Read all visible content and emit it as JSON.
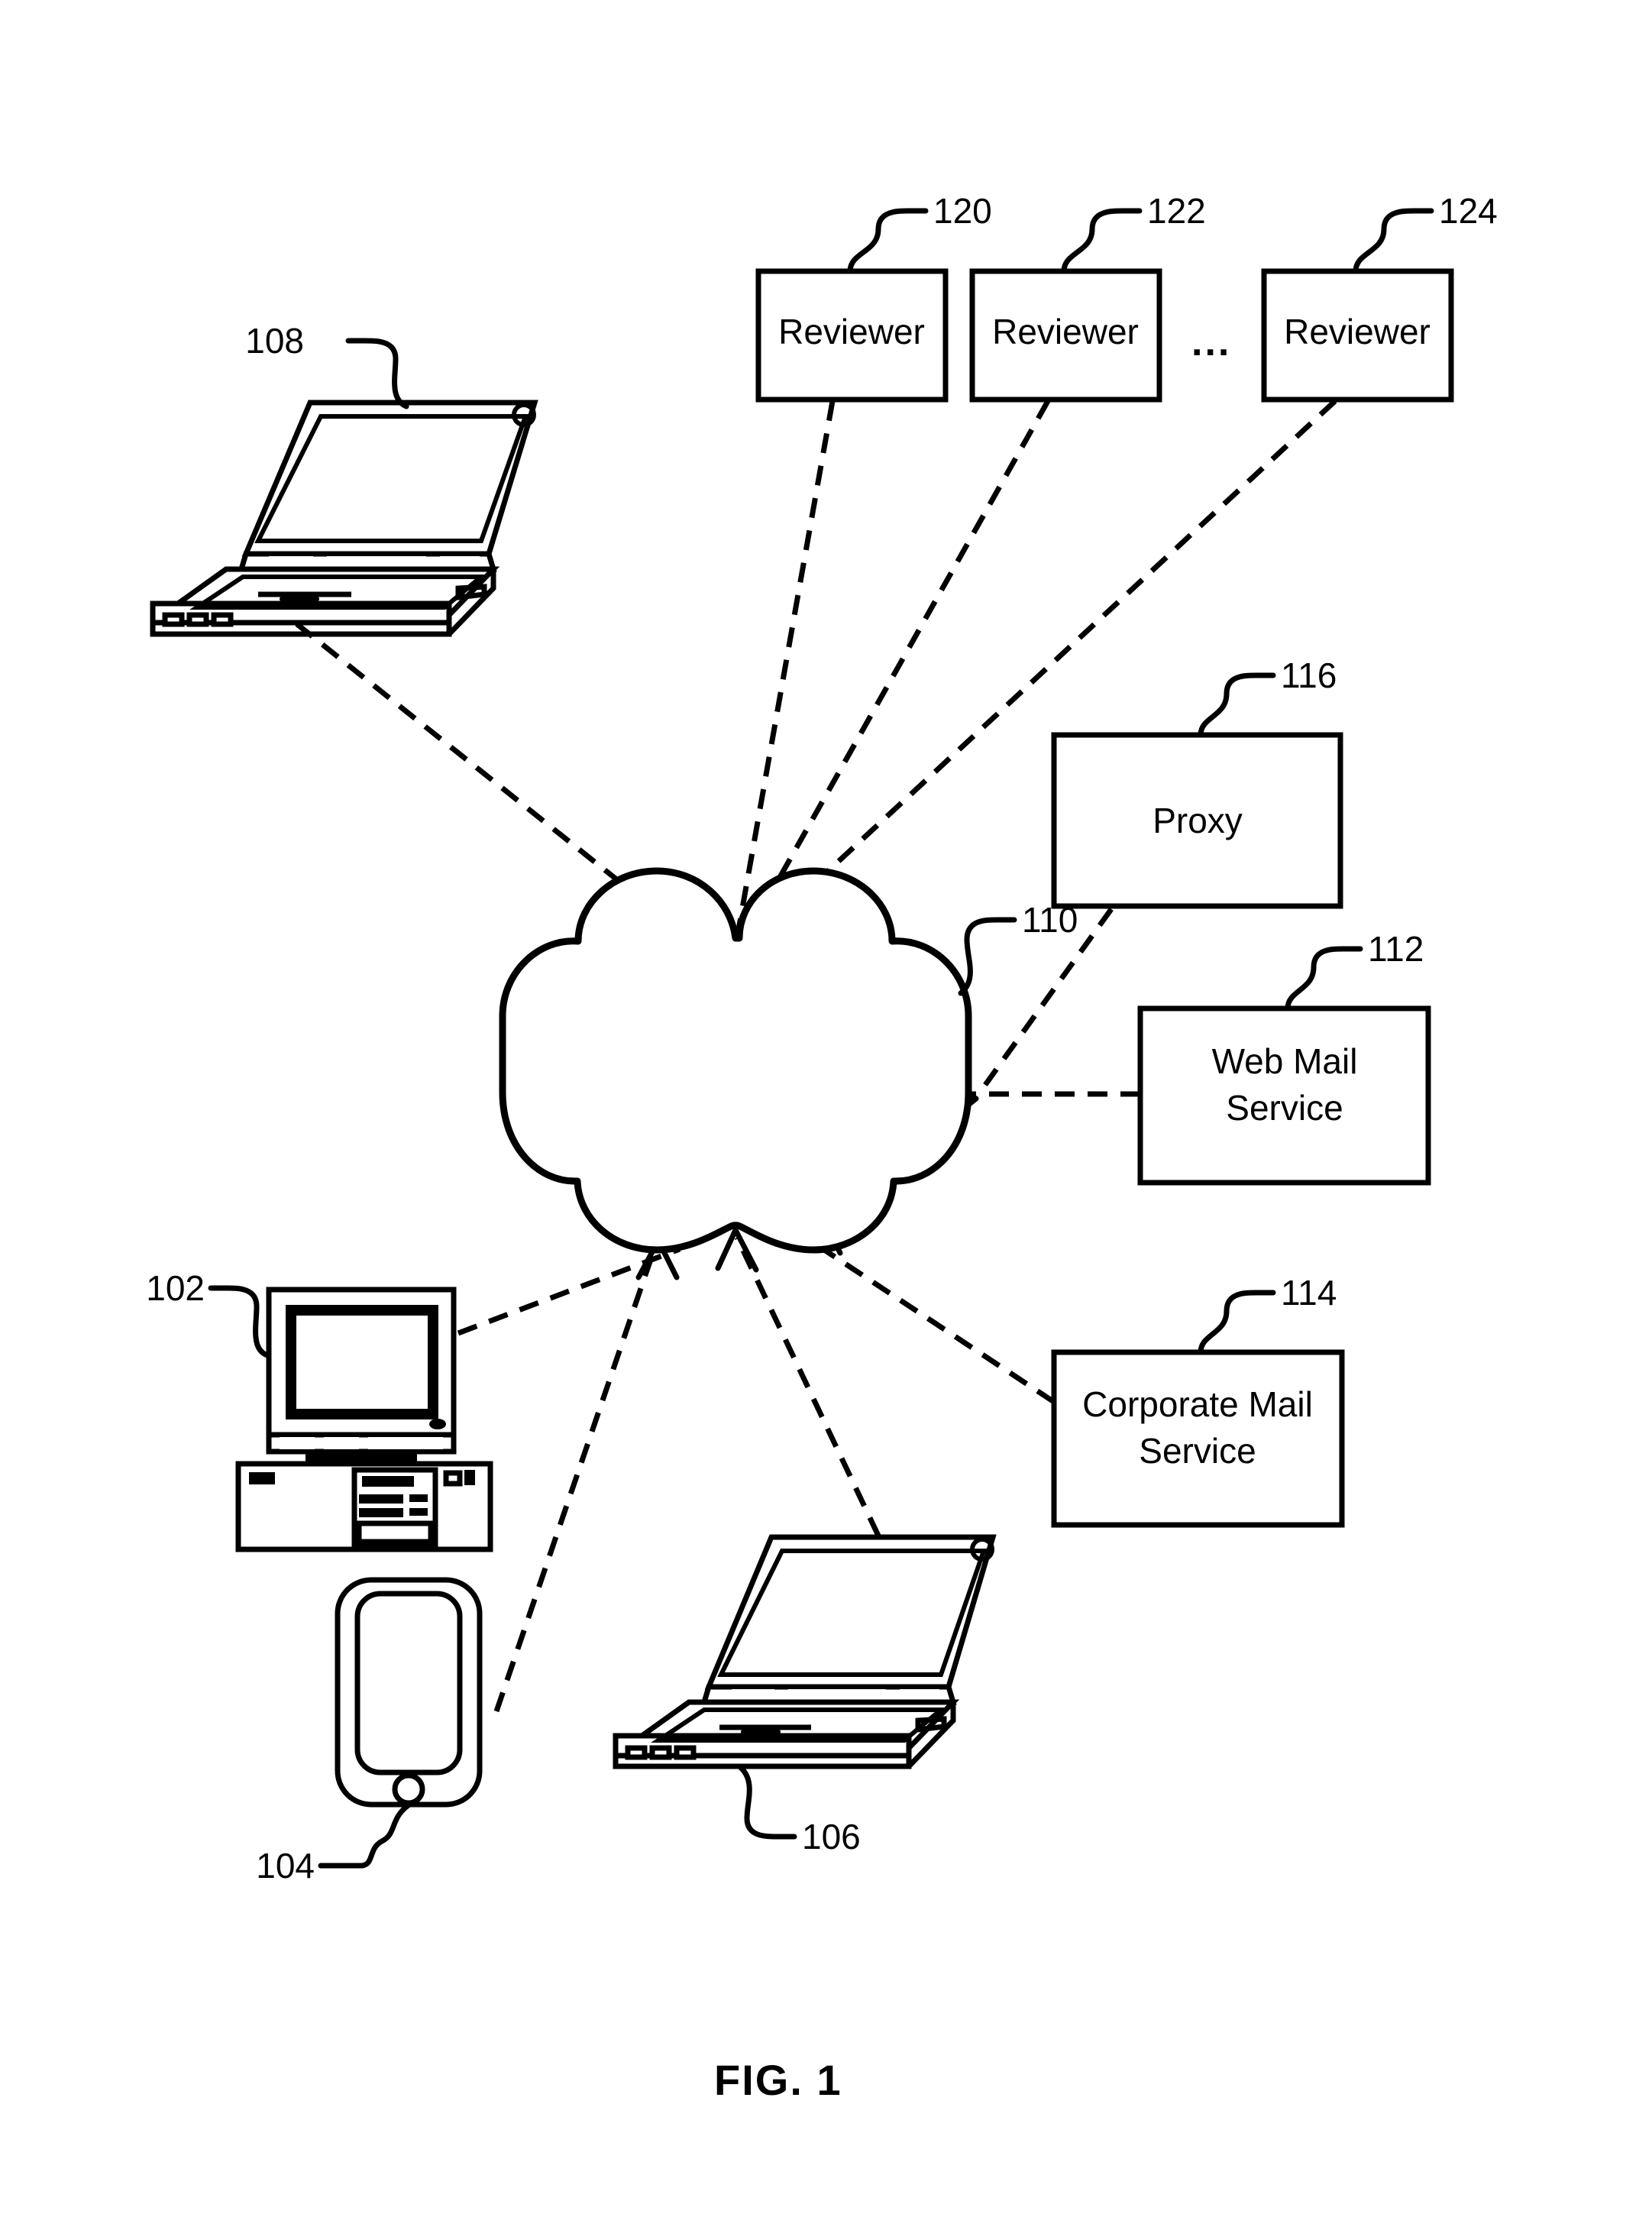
{
  "figure": {
    "caption": "FIG. 1",
    "ellipsis": "...",
    "line_color": "#000000",
    "background_color": "#ffffff"
  },
  "nodes": {
    "reviewer_1": {
      "label": "Reviewer",
      "ref": "120"
    },
    "reviewer_2": {
      "label": "Reviewer",
      "ref": "122"
    },
    "reviewer_n": {
      "label": "Reviewer",
      "ref": "124"
    },
    "proxy": {
      "label": "Proxy",
      "ref": "116"
    },
    "web_mail": {
      "label_line1": "Web Mail",
      "label_line2": "Service",
      "ref": "112"
    },
    "corporate_mail": {
      "label_line1": "Corporate Mail",
      "label_line2": "Service",
      "ref": "114"
    },
    "network_cloud": {
      "label": "",
      "ref": "110"
    },
    "laptop_top": {
      "label": "",
      "ref": "108"
    },
    "desktop_computer": {
      "label": "",
      "ref": "102"
    },
    "mobile_phone": {
      "label": "",
      "ref": "104"
    },
    "laptop_bottom": {
      "label": "",
      "ref": "106"
    }
  },
  "connections": [
    {
      "from": "laptop_top",
      "to": "network_cloud",
      "style": "dashed"
    },
    {
      "from": "reviewer_1",
      "to": "network_cloud",
      "style": "dashed"
    },
    {
      "from": "reviewer_2",
      "to": "network_cloud",
      "style": "dashed"
    },
    {
      "from": "reviewer_n",
      "to": "network_cloud",
      "style": "dashed"
    },
    {
      "from": "proxy",
      "to": "network_cloud",
      "style": "dashed"
    },
    {
      "from": "web_mail",
      "to": "network_cloud",
      "style": "dashed"
    },
    {
      "from": "corporate_mail",
      "to": "network_cloud",
      "style": "dashed"
    },
    {
      "from": "desktop_computer",
      "to": "network_cloud",
      "style": "dashed"
    },
    {
      "from": "mobile_phone",
      "to": "network_cloud",
      "style": "dashed"
    },
    {
      "from": "laptop_bottom",
      "to": "network_cloud",
      "style": "dashed"
    }
  ]
}
